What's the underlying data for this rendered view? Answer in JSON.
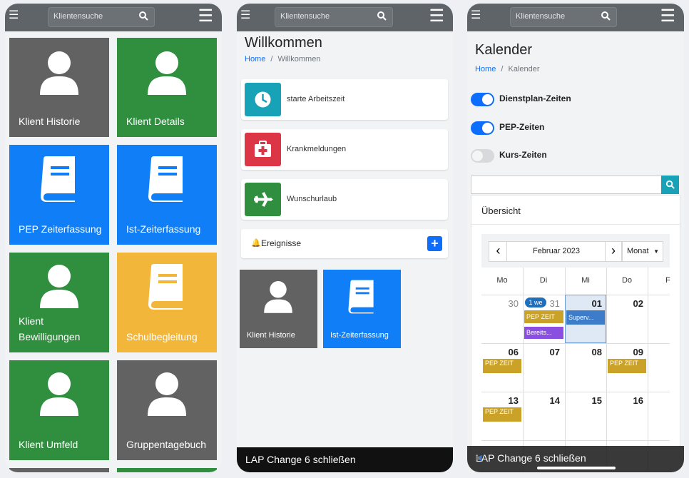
{
  "colors": {
    "topbar": "#5f6469",
    "gray": "#626262",
    "green": "#2f8f3f",
    "blue": "#0f7ef7",
    "yellow": "#f1b63a",
    "teal": "#17a2b8",
    "red": "#dc3545",
    "toggle_on": "#0d6efd",
    "pep": "#c9a227",
    "purple": "#8a4fe0"
  },
  "phone1": {
    "search_placeholder": "Klientensuche",
    "tiles": [
      {
        "label": "Klient Historie",
        "icon": "user-icon"
      },
      {
        "label": "Klient Details",
        "icon": "user-icon"
      },
      {
        "label": "PEP Zeiterfassung",
        "icon": "book-icon"
      },
      {
        "label": "Ist-Zeiterfassung",
        "icon": "book-icon"
      },
      {
        "label": "Klient\nBewilligungen",
        "icon": "user-icon"
      },
      {
        "label": "Schulbegleitung",
        "icon": "book-icon"
      },
      {
        "label": "Klient Umfeld",
        "icon": "user-icon"
      },
      {
        "label": "Gruppentagebuch",
        "icon": "user-icon"
      }
    ]
  },
  "phone2": {
    "search_placeholder": "Klientensuche",
    "title": "Willkommen",
    "breadcrumb": {
      "home": "Home",
      "sep": "/",
      "current": "Willkommen"
    },
    "cards": [
      {
        "label": "starte Arbeitszeit",
        "icon": "clock-icon"
      },
      {
        "label": "Krankmeldungen",
        "icon": "medkit-icon"
      },
      {
        "label": "Wunschurlaub",
        "icon": "plane-icon"
      }
    ],
    "events_label": "Ereignisse",
    "tiles": [
      {
        "label": "Klient Historie",
        "icon": "user-icon"
      },
      {
        "label": "Ist-Zeiterfassung",
        "icon": "book-icon"
      }
    ],
    "bottom_text": "LAP Change 6 schließen"
  },
  "phone3": {
    "search_placeholder": "Klientensuche",
    "title": "Kalender",
    "breadcrumb": {
      "home": "Home",
      "sep": "/",
      "current": "Kalender"
    },
    "toggles": [
      {
        "label": "Dienstplan-Zeiten",
        "on": true
      },
      {
        "label": "PEP-Zeiten",
        "on": true
      },
      {
        "label": "Kurs-Zeiten",
        "on": false
      }
    ],
    "overview_label": "Übersicht",
    "calendar": {
      "prev": "‹",
      "next": "›",
      "month_label": "Februar 2023",
      "view_label": "Monat",
      "weekdays": [
        "Mo",
        "Di",
        "Mi",
        "Do",
        "F"
      ],
      "weeks": [
        [
          "30",
          "31",
          "01",
          "02",
          ""
        ],
        [
          "06",
          "07",
          "08",
          "09",
          ""
        ],
        [
          "13",
          "14",
          "15",
          "16",
          ""
        ]
      ],
      "badge": "1 we",
      "events": {
        "pep": "PEP ZEIT",
        "superv": "Superv...",
        "bereits": "Bereits..."
      }
    },
    "bottom_text": "LAP Change 6 schließen"
  }
}
